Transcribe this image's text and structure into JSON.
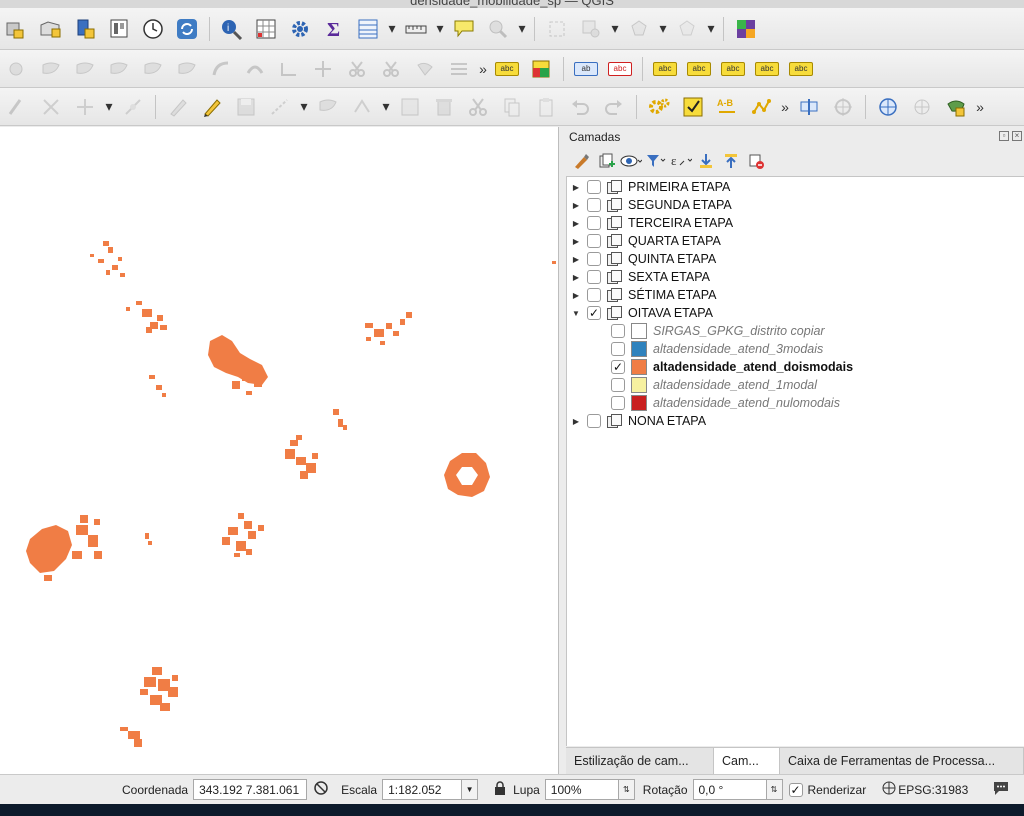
{
  "window": {
    "title": "densidade_mobilidade_sp — QGIS"
  },
  "toolbars": {
    "row1": [
      "open-project",
      "new-print-layout",
      "save-as",
      "bookmark",
      "time-controller",
      "refresh",
      "identify",
      "attribute-table",
      "processing-gear",
      "statistics-sigma",
      "open-table",
      "measure",
      "annotation",
      "select-feature",
      "pan-to-selection",
      "selection-options",
      "zoom-selection",
      "add-layer",
      "color-map"
    ],
    "row2": [
      "digitize-1",
      "digitize-2",
      "digitize-3",
      "digitize-4",
      "digitize-5",
      "digitize-6",
      "digitize-7",
      "digitize-8",
      "digitize-9",
      "digitize-10",
      "digitize-11",
      "digitize-12",
      "label-tool",
      "style-manager",
      "label-pin",
      "label-delete",
      "label-move",
      "label-show",
      "label-rotate",
      "label-change"
    ],
    "row3": [
      "current-edits",
      "toggle-editing",
      "save-edits",
      "add-feature",
      "move-feature",
      "vertex-tool",
      "delete-selected",
      "cut-features",
      "copy-features",
      "paste-features",
      "undo",
      "redo",
      "snapping",
      "field-calculator",
      "text-diff",
      "topology",
      "more-tools"
    ]
  },
  "panel": {
    "title": "Camadas",
    "groups": [
      {
        "label": "PRIMEIRA ETAPA",
        "checked": false,
        "expanded": false
      },
      {
        "label": "SEGUNDA ETAPA",
        "checked": false,
        "expanded": false
      },
      {
        "label": "TERCEIRA ETAPA",
        "checked": false,
        "expanded": false
      },
      {
        "label": "QUARTA ETAPA",
        "checked": false,
        "expanded": false
      },
      {
        "label": "QUINTA ETAPA",
        "checked": false,
        "expanded": false
      },
      {
        "label": "SEXTA ETAPA",
        "checked": false,
        "expanded": false
      },
      {
        "label": "SÉTIMA ETAPA",
        "checked": false,
        "expanded": false
      },
      {
        "label": "OITAVA ETAPA",
        "checked": true,
        "expanded": true
      },
      {
        "label": "NONA ETAPA",
        "checked": false,
        "expanded": false
      }
    ],
    "layers": [
      {
        "label": "SIRGAS_GPKG_distrito copiar",
        "checked": false,
        "color": "#ffffff",
        "style": "italic"
      },
      {
        "label": "altadensidade_atend_3modais",
        "checked": false,
        "color": "#2f82bd",
        "style": "italic"
      },
      {
        "label": "altadensidade_atend_doismodais",
        "checked": true,
        "color": "#f07d45",
        "style": "bold"
      },
      {
        "label": "altadensidade_atend_1modal",
        "checked": false,
        "color": "#f7f1a0",
        "style": "italic"
      },
      {
        "label": "altadensidade_atend_nulomodais",
        "checked": false,
        "color": "#c91f1f",
        "style": "italic"
      }
    ],
    "tabs": {
      "style": "Estilização de cam...",
      "layers": "Cam...",
      "toolbox": "Caixa de Ferramentas de Processa..."
    }
  },
  "statusbar": {
    "coord_label": "Coordenada",
    "coord_value": "343.192  7.381.061",
    "scale_label": "Escala",
    "scale_value": "1:182.052",
    "zoom_label": "Lupa",
    "zoom_value": "100%",
    "rotation_label": "Rotação",
    "rotation_value": "0,0 °",
    "render_label": "Renderizar",
    "render_checked": true,
    "crs": "EPSG:31983"
  },
  "map": {
    "fill_color": "#f07d45"
  }
}
